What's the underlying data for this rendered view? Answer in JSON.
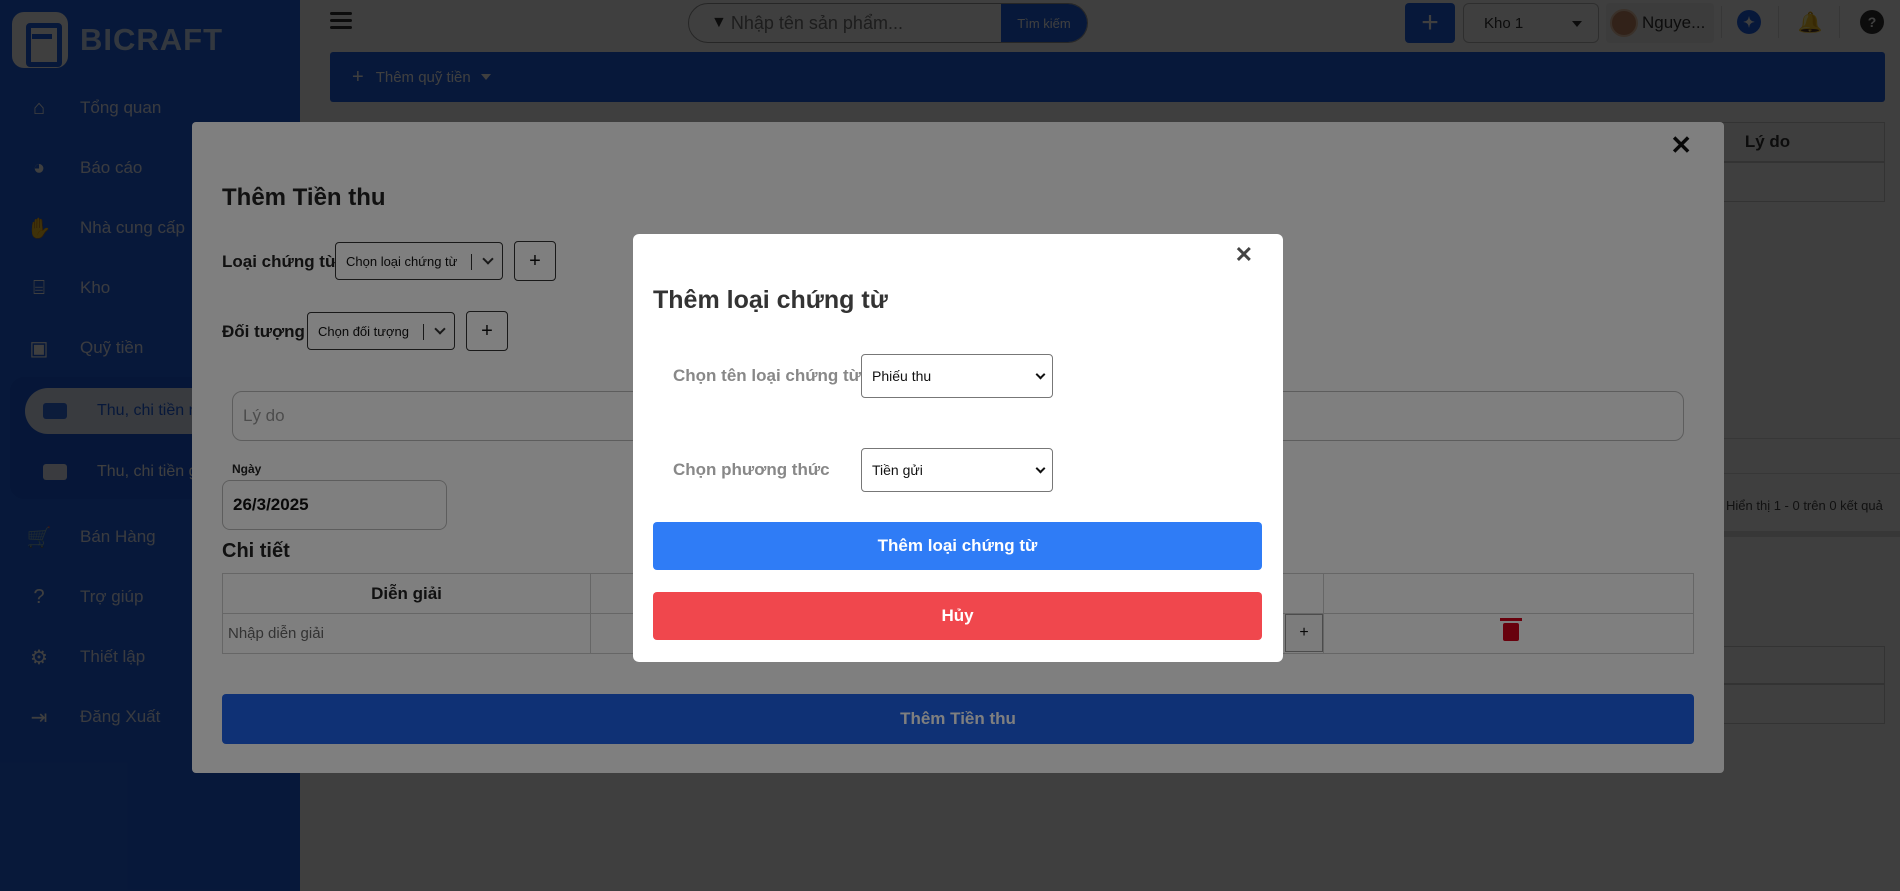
{
  "app": {
    "brand": "BICRAFT"
  },
  "sidebar": {
    "items": [
      {
        "label": "Tổng quan",
        "icon": "home-icon"
      },
      {
        "label": "Báo cáo",
        "icon": "pie-chart-icon"
      },
      {
        "label": "Nhà cung cấp",
        "icon": "handshake-icon"
      },
      {
        "label": "Kho",
        "icon": "bank-icon"
      },
      {
        "label": "Quỹ tiền",
        "icon": "wallet-icon"
      },
      {
        "label": "Bán Hàng",
        "icon": "cart-icon"
      },
      {
        "label": "Trợ giúp",
        "icon": "help-icon"
      },
      {
        "label": "Thiết lập",
        "icon": "gear-icon"
      },
      {
        "label": "Đăng Xuất",
        "icon": "logout-icon"
      }
    ],
    "subitems": [
      {
        "label": "Thu, chi tiền mặt"
      },
      {
        "label": "Thu, chi tiền gửi"
      }
    ]
  },
  "topbar": {
    "search_placeholder": "Nhập tên sản phẩm...",
    "search_button": "Tìm kiếm",
    "add_button": "+",
    "store_value": "Kho 1",
    "user_name": "Nguye..."
  },
  "page": {
    "fund_button": "Thêm quỹ tiền",
    "table_header_reason": "Lý do",
    "pager_text": "Hiển thị 1 - 0 trên 0 kết quả"
  },
  "modal1": {
    "title": "Thêm Tiền thu",
    "doc_type_label": "Loại chứng từ",
    "doc_type_select": "Chọn loại chứng từ",
    "object_label": "Đối tượng",
    "object_select": "Chọn đối tượng",
    "plus": "+",
    "reason_placeholder": "Lý do",
    "date_label": "Ngày",
    "date_value": "26/3/2025",
    "detail_title": "Chi tiết",
    "table_header_desc": "Diễn giải",
    "desc_placeholder": "Nhập diễn giải",
    "submit": "Thêm Tiền thu",
    "close": "✕"
  },
  "modal2": {
    "title": "Thêm loại chứng từ",
    "name_label": "Chọn tên loại chứng từ",
    "name_value": "Phiếu thu",
    "method_label": "Chọn phương thức",
    "method_value": "Tiền gửi",
    "add_button": "Thêm loại chứng từ",
    "cancel_button": "Hủy",
    "close": "✕"
  },
  "colors": {
    "primary": "#1f63ea",
    "add_button": "#2f7cf6",
    "cancel_button": "#f0474d",
    "trash": "#d0021b"
  }
}
